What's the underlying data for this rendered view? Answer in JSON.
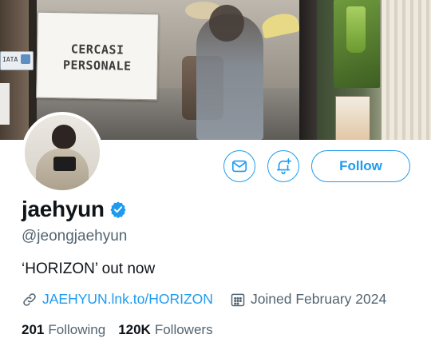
{
  "banner": {
    "sign_line_1": "CERCASI",
    "sign_line_2": "PERSONALE",
    "tag_text": "IATA"
  },
  "profile": {
    "display_name": "jaehyun",
    "verified_icon": "verified-badge-icon",
    "handle": "@jeongjaehyun",
    "bio": "‘HORIZON’ out now",
    "link": "JAEHYUN.lnk.to/HORIZON",
    "joined": "Joined February 2024"
  },
  "actions": {
    "message_icon": "envelope-icon",
    "notify_icon": "bell-plus-icon",
    "follow_label": "Follow"
  },
  "stats": {
    "following_count": "201",
    "following_label": "Following",
    "followers_count": "120K",
    "followers_label": "Followers"
  },
  "colors": {
    "accent": "#1d9bf0",
    "secondary_text": "#536471",
    "primary_text": "#0f1419"
  }
}
